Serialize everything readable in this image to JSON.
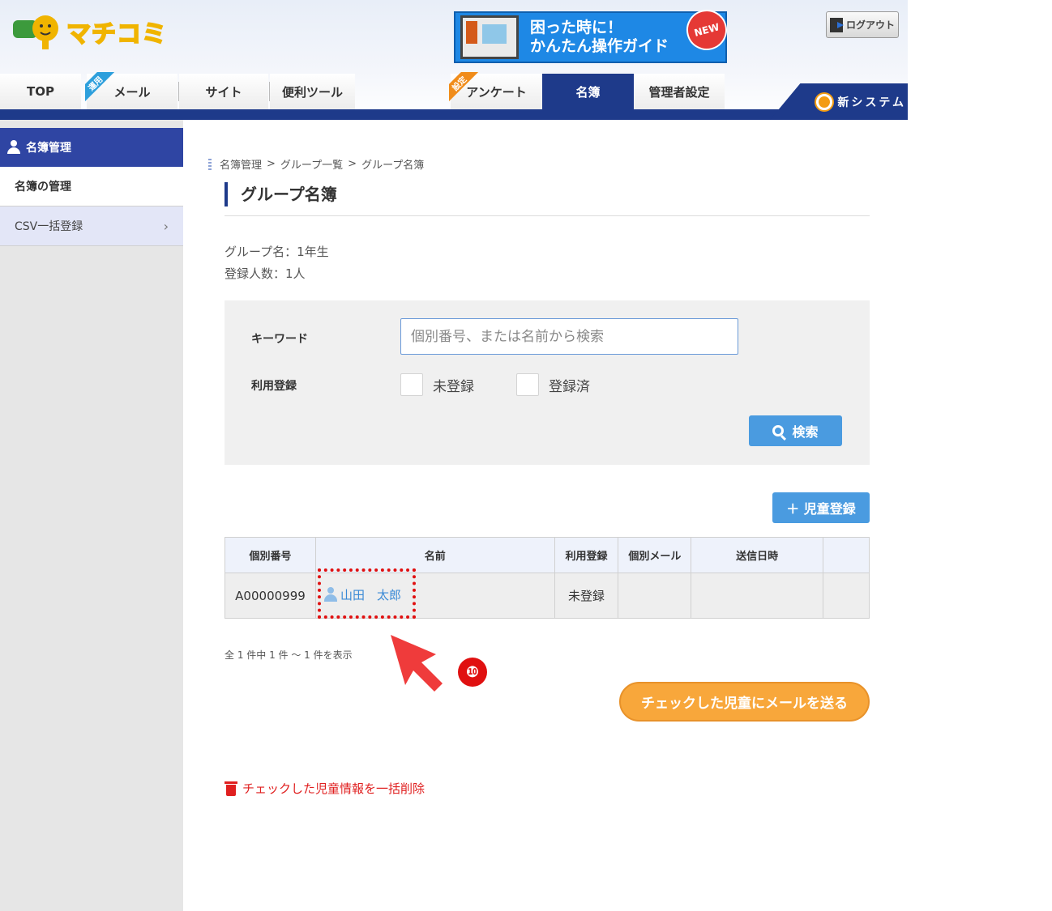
{
  "header": {
    "logo_text": "マチコミ",
    "guide_banner": {
      "line1": "困った時に！",
      "line2": "かんたん操作ガイド",
      "badge": "NEW"
    },
    "logout_label": "ログアウト",
    "new_system_label": "新システム"
  },
  "nav": {
    "tabs": [
      {
        "label": "TOP"
      },
      {
        "label": "メール",
        "ribbon": "運用"
      },
      {
        "label": "サイト"
      },
      {
        "label": "便利ツール"
      },
      {
        "label": "アンケート",
        "ribbon": "設定"
      },
      {
        "label": "名簿",
        "active": true
      },
      {
        "label": "管理者設定"
      }
    ]
  },
  "sidebar": {
    "heading": "名簿管理",
    "items": [
      {
        "label": "名簿の管理"
      },
      {
        "label": "CSV一括登録"
      }
    ]
  },
  "breadcrumb": [
    "名簿管理",
    ">",
    "グループ一覧",
    ">",
    "グループ名簿"
  ],
  "page_title": "グループ名簿",
  "group_info": {
    "group_name": "グループ名：1年生",
    "member_count": "登録人数：1人"
  },
  "search": {
    "keyword_label": "キーワード",
    "keyword_placeholder": "個別番号、または名前から検索",
    "registration_label": "利用登録",
    "option_unregistered": "未登録",
    "option_registered": "登録済",
    "search_button": "検索"
  },
  "add_button": "＋ 児童登録",
  "table": {
    "headers": [
      "個別番号",
      "名前",
      "利用登録",
      "個別メール",
      "送信日時",
      ""
    ],
    "rows": [
      {
        "id": "A00000999",
        "name": "山田　太郎",
        "status": "未登録",
        "mail": "",
        "sent": "",
        "extra": ""
      }
    ]
  },
  "result_count": "全 1 件中 1 件 ～ 1 件を表示",
  "send_mail_button": "チェックした児童にメールを送る",
  "bulk_delete_link": "チェックした児童情報を一括削除",
  "annotation": {
    "step_number": "❿"
  },
  "colors": {
    "brand_navy": "#1e3a8a",
    "button_blue": "#4a9be0",
    "mail_orange": "#f8a73b",
    "alert_red": "#e02020"
  }
}
